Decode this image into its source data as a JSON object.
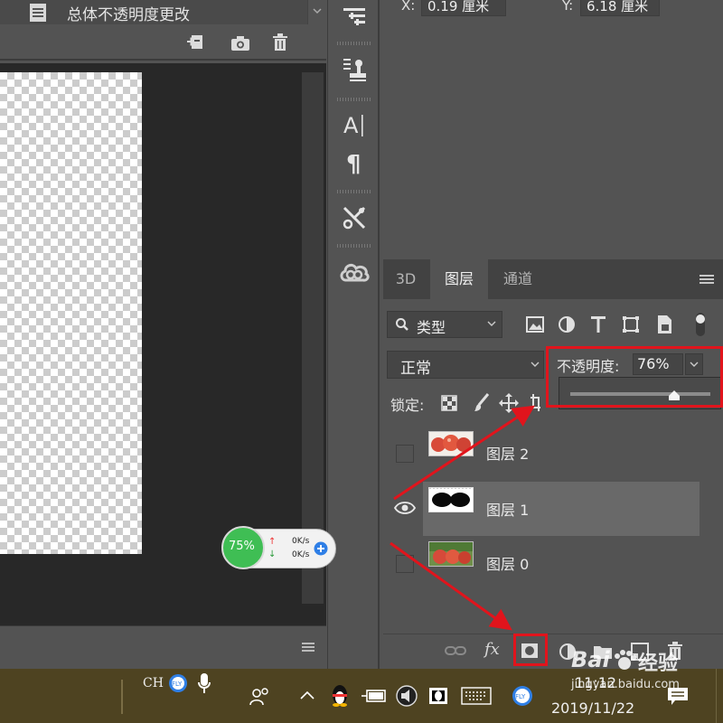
{
  "history": {
    "state_label": "总体不透明度更改"
  },
  "info_panel": {
    "x_label": "X:",
    "x_value": "0.19 厘米",
    "y_label": "Y:",
    "y_value": "6.18 厘米"
  },
  "layers_panel": {
    "tabs": [
      {
        "label": "3D"
      },
      {
        "label": "图层"
      },
      {
        "label": "通道"
      }
    ],
    "filter_value": "类型",
    "blend_mode": "正常",
    "opacity_label": "不透明度:",
    "opacity_value": "76%",
    "opacity_slider_fraction": 0.74,
    "lock_label": "锁定:",
    "layers": [
      {
        "name": "图层 2",
        "visible": false,
        "selected": false
      },
      {
        "name": "图层 1",
        "visible": true,
        "selected": true
      },
      {
        "name": "图层 0",
        "visible": false,
        "selected": false
      }
    ],
    "fx_label": "fx"
  },
  "speed_widget": {
    "percent": "75%",
    "upload": "0K/s",
    "download": "0K/s"
  },
  "taskbar": {
    "ime_label": "CH",
    "time": "11:12",
    "date": "2019/11/22"
  },
  "watermark": {
    "brand": "Bai",
    "brand_cn": "经验",
    "url": "jingyan.baidu.com"
  },
  "colors": {
    "annotation_red": "#e1141c",
    "panel_bg": "#535353",
    "taskbar_bg": "#4e4321"
  }
}
